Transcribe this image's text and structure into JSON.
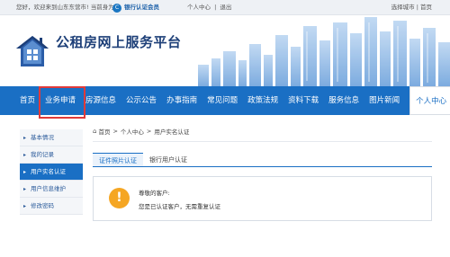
{
  "topbar": {
    "greeting": "您好，欢迎来到山东东营市!",
    "current_label": "当前身为:",
    "member_label": "银行认证会员",
    "links": [
      "个人中心",
      "|",
      "退出"
    ],
    "city_select": "选择城市 | 首页"
  },
  "header": {
    "site_title": "公租房网上服务平台"
  },
  "nav": {
    "items": [
      "首页",
      "业务申请",
      "房源信息",
      "公示公告",
      "办事指南",
      "常见问题",
      "政策法规",
      "资料下载",
      "服务信息",
      "图片新闻",
      "个人中心"
    ],
    "active_index": 10,
    "highlighted_index": 1
  },
  "sidebar": {
    "items": [
      "基本情况",
      "我的记录",
      "用户实名认证",
      "用户信息维护",
      "修改密码"
    ],
    "active_index": 2
  },
  "breadcrumb": {
    "items": [
      "首页",
      "个人中心",
      "用户实名认证"
    ]
  },
  "tabs": {
    "items": [
      "证件照片认证",
      "银行用户认证"
    ],
    "active_index": 0
  },
  "message": {
    "title": "尊敬的客户:",
    "text": "您是已认证客户，无需重复认证"
  },
  "colors": {
    "nav_blue": "#1a6fc4",
    "highlight_red": "#e03a3a",
    "warning_orange": "#f5a623"
  }
}
